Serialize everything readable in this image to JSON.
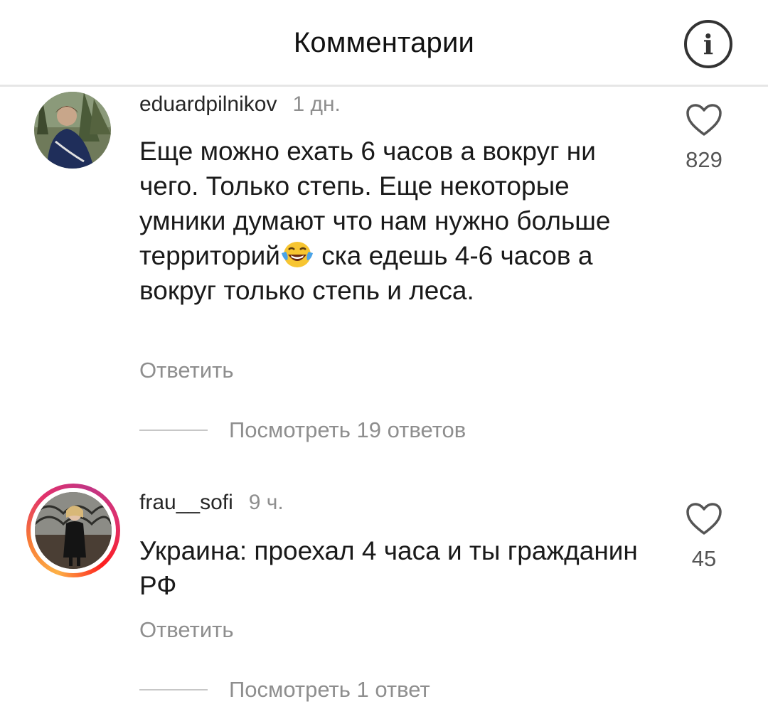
{
  "header": {
    "title": "Комментарии",
    "info_icon": "i"
  },
  "comments": [
    {
      "username": "eduardpilnikov",
      "time": "1 дн.",
      "text_before_emoji": "Еще можно ехать 6 часов а вокруг ни чего. Только степь. Еще некоторые умники думают что нам нужно больше территорий",
      "emoji": "face-with-tears-of-joy",
      "text_after_emoji": " ска едешь 4-6 часов а вокруг только степь и леса.",
      "reply_label": "Ответить",
      "likes": "829",
      "view_replies": "Посмотреть 19 ответов"
    },
    {
      "username": "frau__sofi",
      "time": "9 ч.",
      "text": "Украина: проехал 4 часа и ты гражданин РФ",
      "reply_label": "Ответить",
      "likes": "45",
      "view_replies": "Посмотреть 1 ответ",
      "has_story_ring": true
    }
  ],
  "colors": {
    "text_primary": "#262626",
    "text_secondary": "#8e8e8e",
    "divider": "#e6e6e6"
  }
}
